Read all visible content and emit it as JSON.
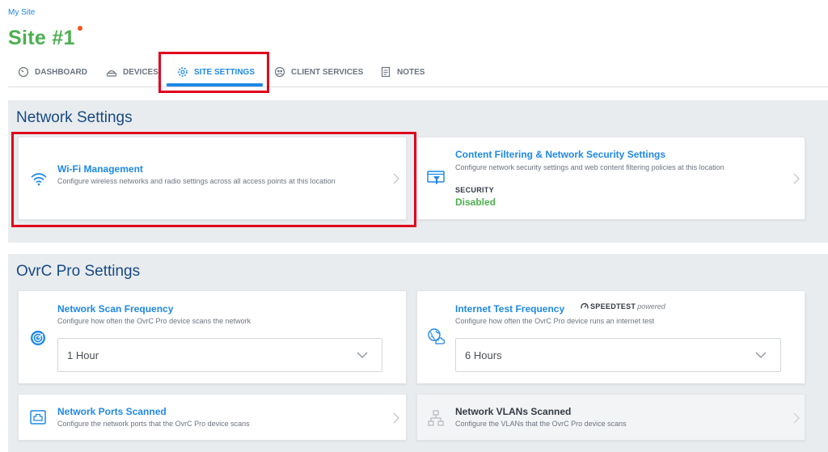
{
  "breadcrumb": "My Site",
  "site": {
    "title": "Site #1"
  },
  "tabs": [
    {
      "label": "DASHBOARD",
      "icon": "dashboard-gauge-icon"
    },
    {
      "label": "DEVICES",
      "icon": "devices-router-icon"
    },
    {
      "label": "SITE SETTINGS",
      "icon": "gear-icon",
      "active": true
    },
    {
      "label": "CLIENT SERVICES",
      "icon": "client-services-icon"
    },
    {
      "label": "NOTES",
      "icon": "notes-icon"
    }
  ],
  "network_settings": {
    "title": "Network Settings",
    "wifi": {
      "title": "Wi-Fi Management",
      "description": "Configure wireless networks and radio settings across all access points at this location",
      "icon": "wifi-icon"
    },
    "content_filtering": {
      "title": "Content Filtering & Network Security Settings",
      "description": "Configure network security settings and web content filtering policies at this location",
      "security_label": "SECURITY",
      "security_value": "Disabled",
      "icon": "content-filter-icon"
    }
  },
  "ovrc_settings": {
    "title": "OvrC Pro Settings",
    "scan_frequency": {
      "title": "Network Scan Frequency",
      "description": "Configure how often the OvrC Pro device scans the network",
      "selected": "1 Hour",
      "icon": "radar-scan-icon"
    },
    "internet_test": {
      "title": "Internet Test Frequency",
      "badge_brand": "SPEEDTEST",
      "badge_suffix": "powered",
      "description": "Configure how often the OvrC Pro device runs an internet test",
      "selected": "6 Hours",
      "icon": "globe-cloud-icon"
    },
    "ports_scanned": {
      "title": "Network Ports Scanned",
      "description": "Configure the network ports that the OvrC Pro device scans",
      "icon": "network-port-icon"
    },
    "vlans_scanned": {
      "title": "Network VLANs Scanned",
      "description": "Configure the VLANs that the OvrC Pro device scans",
      "icon": "network-topology-icon"
    }
  },
  "colors": {
    "accent": "#1e88e5",
    "site_title": "#4caf50",
    "section_title": "#174a85",
    "disabled_status": "#4caf50",
    "highlight": "#e0001b"
  }
}
